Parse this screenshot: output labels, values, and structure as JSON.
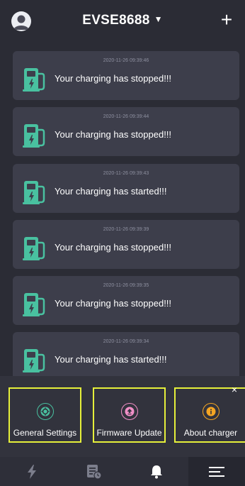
{
  "header": {
    "device_name": "EVSE8688",
    "caret_glyph": "▼",
    "add_glyph": "+"
  },
  "notifications": [
    {
      "timestamp": "2020-11-26 09:39:46",
      "message": "Your charging has stopped!!!"
    },
    {
      "timestamp": "2020-11-26 09:39:44",
      "message": "Your charging has stopped!!!"
    },
    {
      "timestamp": "2020-11-26 09:39:43",
      "message": "Your charging has started!!!"
    },
    {
      "timestamp": "2020-11-26 09:39:39",
      "message": "Your charging has stopped!!!"
    },
    {
      "timestamp": "2020-11-26 09:39:35",
      "message": "Your charging has stopped!!!"
    },
    {
      "timestamp": "2020-11-26 09:39:34",
      "message": "Your charging has started!!!"
    }
  ],
  "menu": {
    "close_glyph": "×",
    "options": [
      {
        "label": "General Settings",
        "icon": "gear-icon",
        "color": "#49c1a0"
      },
      {
        "label": "Firmware Update",
        "icon": "upload-icon",
        "color": "#f290c8"
      },
      {
        "label": "About charger",
        "icon": "info-icon",
        "color": "#f5a623"
      }
    ]
  },
  "tabbar": {
    "tabs": [
      {
        "icon": "lightning-icon"
      },
      {
        "icon": "records-icon"
      },
      {
        "icon": "bell-icon"
      },
      {
        "icon": "menu-icon",
        "active": true
      }
    ]
  },
  "colors": {
    "background": "#2b2c35",
    "card": "#3d3e4b",
    "accent_green": "#49c1a0",
    "highlight": "#e6f03a"
  }
}
